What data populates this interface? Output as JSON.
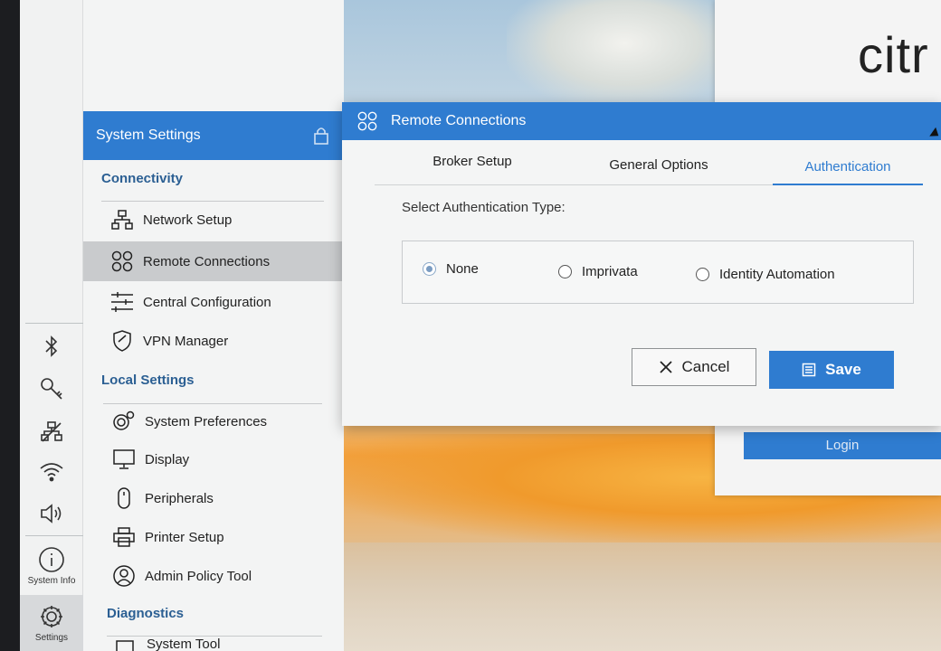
{
  "login": {
    "brand": "citr",
    "button_label": "Login"
  },
  "strip": {
    "items": [
      {
        "name": "bluetooth",
        "icon": "bluetooth-icon"
      },
      {
        "name": "key",
        "icon": "key-icon"
      },
      {
        "name": "network-off",
        "icon": "network-icon"
      },
      {
        "name": "wifi",
        "icon": "wifi-icon"
      },
      {
        "name": "volume",
        "icon": "volume-icon"
      }
    ],
    "system_info_label": "System Info",
    "settings_label": "Settings"
  },
  "settings_panel": {
    "title": "System Settings",
    "sections": {
      "connectivity": "Connectivity",
      "local": "Local Settings",
      "diagnostics": "Diagnostics"
    },
    "items": {
      "network_setup": "Network Setup",
      "remote_connections": "Remote Connections",
      "central_configuration": "Central Configuration",
      "vpn_manager": "VPN Manager",
      "system_preferences": "System Preferences",
      "display": "Display",
      "peripherals": "Peripherals",
      "printer_setup": "Printer Setup",
      "admin_policy_tool": "Admin Policy Tool",
      "system_tools": "System Tool"
    },
    "selected": "remote_connections"
  },
  "dialog": {
    "title": "Remote Connections",
    "tabs": [
      "Broker Setup",
      "General Options",
      "Authentication"
    ],
    "active_tab": "Authentication",
    "auth_label": "Select Authentication Type:",
    "options": [
      "None",
      "Imprivata",
      "Identity Automation"
    ],
    "selected_option": "None",
    "cancel_label": "Cancel",
    "save_label": "Save"
  },
  "colors": {
    "accent": "#2f7cd0",
    "section_text": "#2b5f93",
    "selected_row": "#c9cbcd"
  }
}
